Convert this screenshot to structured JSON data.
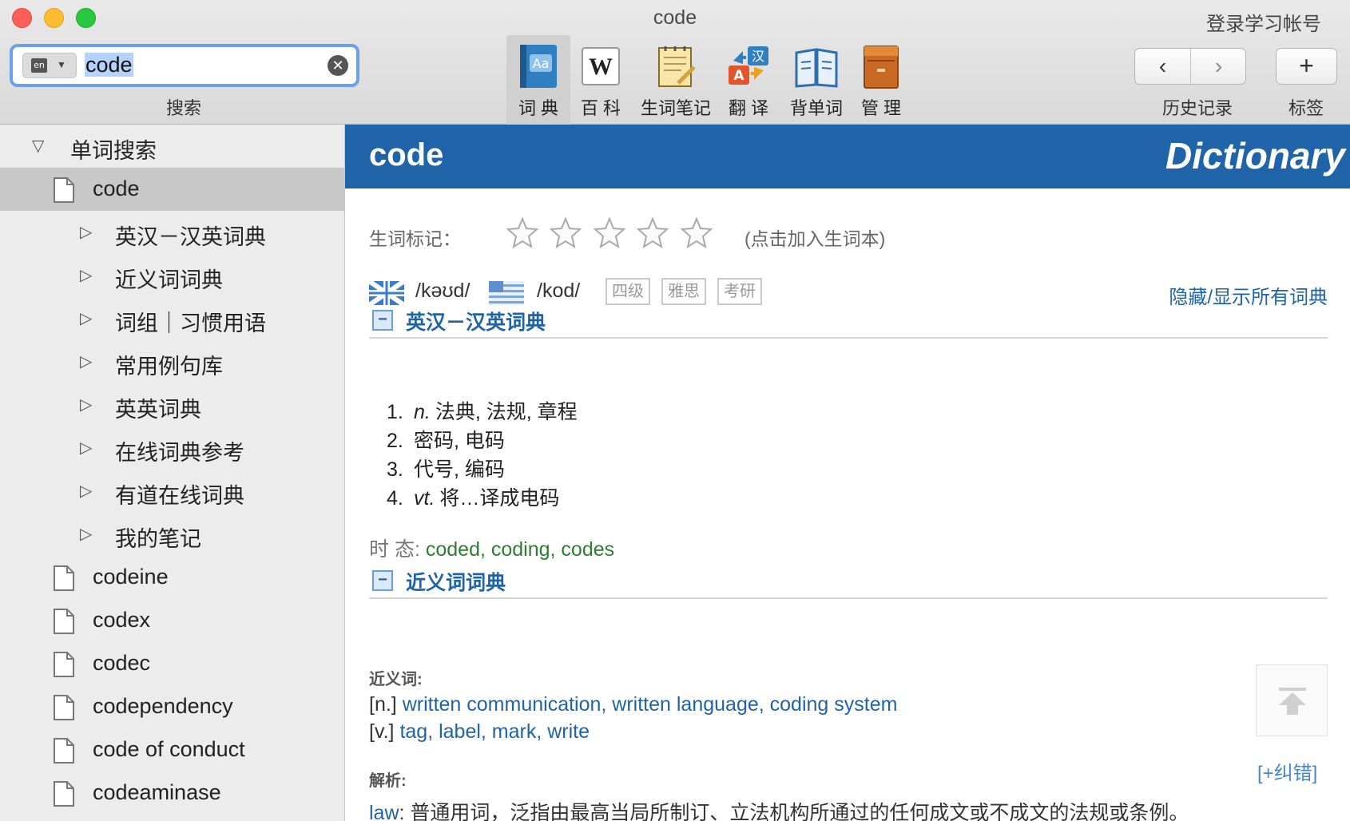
{
  "window": {
    "title": "code",
    "login_label": "登录学习帐号"
  },
  "search": {
    "lang_badge": "en",
    "query": "code",
    "label": "搜索"
  },
  "toolbar": {
    "tools": [
      {
        "label": "词 典",
        "icon": "dictionary-book-icon",
        "active": true
      },
      {
        "label": "百 科",
        "icon": "wikipedia-icon",
        "active": false
      },
      {
        "label": "生词笔记",
        "icon": "notepad-icon",
        "active": false
      },
      {
        "label": "翻 译",
        "icon": "translate-icon",
        "active": false
      },
      {
        "label": "背单词",
        "icon": "open-book-icon",
        "active": false
      },
      {
        "label": "管 理",
        "icon": "cabinet-icon",
        "active": false
      }
    ],
    "history_label": "历史记录",
    "bookmark_label": "标签",
    "translate_glyph_zh": "汉",
    "translate_glyph_en": "A",
    "wiki_glyph": "W",
    "dict_glyph": "Aa"
  },
  "sidebar": {
    "group_label": "单词搜索",
    "selected_word": "code",
    "sources": [
      "英汉－汉英词典",
      "近义词词典",
      "词组｜习惯用语",
      "常用例句库",
      "英英词典",
      "在线词典参考",
      "有道在线词典",
      "我的笔记"
    ],
    "words": [
      "codeine",
      "codex",
      "codec",
      "codependency",
      "code of conduct",
      "codeaminase"
    ]
  },
  "entry": {
    "word": "code",
    "brand": "Dictionary",
    "star_label": "生词标记：",
    "star_rating": 0,
    "star_hint": "(点击加入生词本)",
    "uk_phonetic": "/kəʊd/",
    "us_phonetic": "/kod/",
    "tags": [
      "四级",
      "雅思",
      "考研"
    ],
    "toggle_all": "隐藏/显示所有词典"
  },
  "sections": {
    "ec": {
      "title": "英汉－汉英词典",
      "definitions": [
        {
          "num": "1.",
          "pos": "n.",
          "text": "法典, 法规, 章程"
        },
        {
          "num": "2.",
          "pos": "",
          "text": "密码, 电码"
        },
        {
          "num": "3.",
          "pos": "",
          "text": "代号, 编码"
        },
        {
          "num": "4.",
          "pos": "vt.",
          "text": "将…译成电码"
        }
      ],
      "tense_label": "时 态:",
      "tense_forms": "coded, coding, codes"
    },
    "syn": {
      "title": "近义词词典",
      "syn_label": "近义词:",
      "noun_pos": "[n.]",
      "noun_syns": "written communication, written language, coding system",
      "verb_pos": "[v.]",
      "verb_syns": "tag, label, mark, write",
      "analysis_label": "解析:",
      "analysis_word": "law",
      "analysis_text": ": 普通用词，泛指由最高当局所制订、立法机构所通过的任何成文或不成文的法规或条例。",
      "fix_link": "[+纠错]"
    }
  },
  "colors": {
    "accent": "#1f63a8",
    "tense": "#2e7d32",
    "banner": "#1f63a8"
  }
}
